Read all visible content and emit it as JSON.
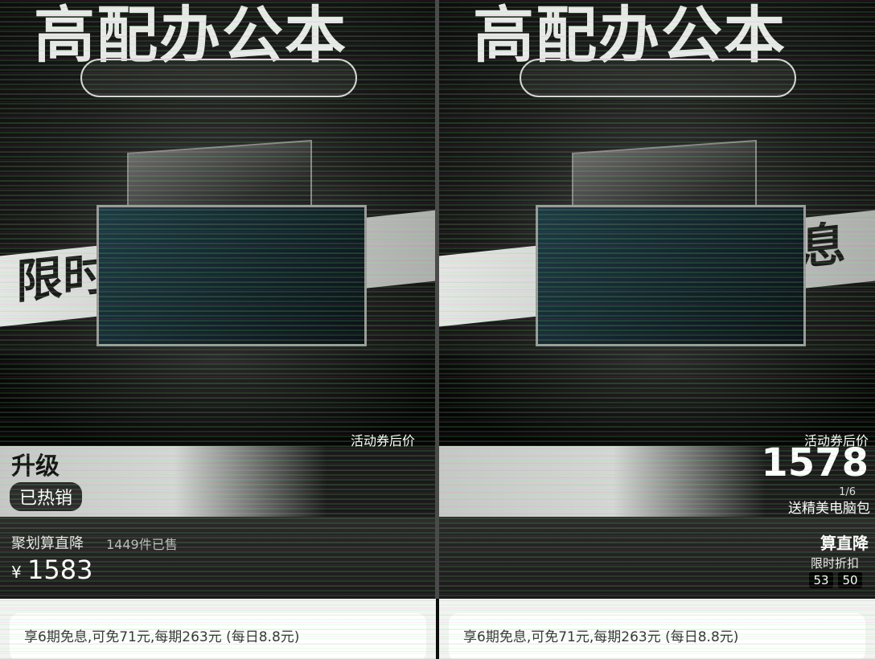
{
  "left": {
    "headline": "高配办公本",
    "banner": "限时",
    "upgrade": "升级",
    "hot_badge": "已热销",
    "coupon_label": "活动券后价",
    "channel": "聚划算直降",
    "sold": "1449件已售",
    "currency": "¥",
    "price": "1583",
    "installment": "享6期免息,可免71元,每期263元 (每日8.8元)"
  },
  "right": {
    "headline": "高配办公本",
    "banner": "免息",
    "coupon_label": "活动券后价",
    "big_price": "1578",
    "image_counter": "1/6",
    "gift": "送精美电脑包",
    "direct_drop": "算直降",
    "limited": "限时折扣",
    "timer": [
      "53",
      "50"
    ],
    "installment": "享6期免息,可免71元,每期263元 (每日8.8元)"
  }
}
